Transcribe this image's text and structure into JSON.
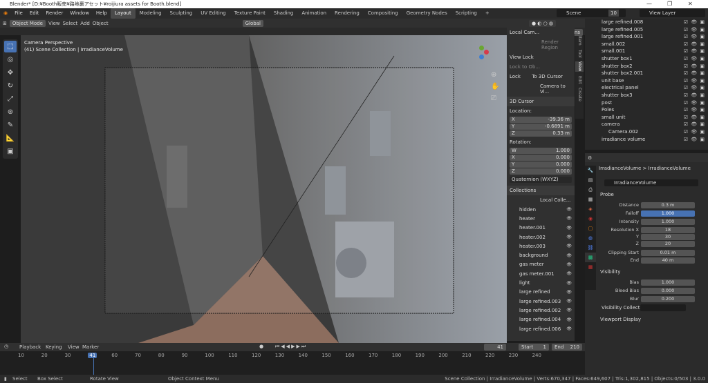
{
  "title": "Blender* [D:¥Booth販売¥路地裏アセット¥roijiura assets for Booth.blend]",
  "menu": [
    "File",
    "Edit",
    "Render",
    "Window",
    "Help"
  ],
  "workspaces": [
    "Layout",
    "Modeling",
    "Sculpting",
    "UV Editing",
    "Texture Paint",
    "Shading",
    "Animation",
    "Rendering",
    "Compositing",
    "Geometry Nodes",
    "Scripting"
  ],
  "scene_label": "Scene",
  "view_layer_label": "View Layer",
  "scene_num": "10",
  "viewport": {
    "mode": "Object Mode",
    "menus": [
      "View",
      "Select",
      "Add",
      "Object"
    ],
    "transform": "Global",
    "options": "Options",
    "camera_text": "Camera Perspective",
    "collection_text": "(41) Scene Collection | IrradianceVolume"
  },
  "npanel": {
    "tabs": [
      "Item",
      "Tool",
      "View",
      "Edit",
      "Create"
    ],
    "local_camera": "Local Cam...",
    "render_region": "Render Region",
    "view_lock": "View Lock",
    "lock_to_obj": "Lock to Ob...",
    "lock": "Lock",
    "to_3d_cursor": "To 3D Cursor",
    "camera_to_view": "Camera to Vi...",
    "cursor_title": "3D Cursor",
    "location": "Location:",
    "loc": [
      {
        "a": "X",
        "v": "-39.36 m"
      },
      {
        "a": "Y",
        "v": "-0.6891 m"
      },
      {
        "a": "Z",
        "v": "0.33 m"
      }
    ],
    "rotation": "Rotation:",
    "rot": [
      {
        "a": "W",
        "v": "1.000"
      },
      {
        "a": "X",
        "v": "0.000"
      },
      {
        "a": "Y",
        "v": "0.000"
      },
      {
        "a": "Z",
        "v": "0.000"
      }
    ],
    "rot_mode": "Quaternion (WXYZ)",
    "collections_title": "Collections",
    "local_collections": "Local Colle...",
    "collections": [
      "hidden",
      "heater",
      "heater.001",
      "heater.002",
      "heater.003",
      "background",
      "gas meter",
      "gas meter.001",
      "light",
      "large refined",
      "large refined.003",
      "large refined.002",
      "large refined.004",
      "large refined.006"
    ]
  },
  "outliner": [
    "large refined.008",
    "large refined.005",
    "large refined.001",
    "small.002",
    "small.001",
    "shutter box1",
    "shutter box2",
    "shutter box2.001",
    "unit base",
    "electrical panel",
    "shutter box3",
    "post",
    "Poles",
    "small unit",
    "camera",
    "Camera.002",
    "irradiance volume"
  ],
  "props": {
    "crumb1": "IrradianceVolume",
    "crumb2": "IrradianceVolume",
    "data_name": "IrradianceVolume",
    "probe": "Probe",
    "rows": [
      {
        "l": "Distance",
        "v": "0.3 m"
      },
      {
        "l": "Falloff",
        "v": "1.000"
      },
      {
        "l": "Intensity",
        "v": "1.000"
      },
      {
        "l": "Resolution X",
        "v": "18"
      },
      {
        "l": "Y",
        "v": "30"
      },
      {
        "l": "Z",
        "v": "20"
      },
      {
        "l": "Clipping Start",
        "v": "0.01 m"
      },
      {
        "l": "End",
        "v": "40 m"
      }
    ],
    "visibility": "Visibility",
    "vrows": [
      {
        "l": "Bias",
        "v": "1.000"
      },
      {
        "l": "Bleed Bias",
        "v": "0.000"
      },
      {
        "l": "Blur",
        "v": "0.200"
      }
    ],
    "vis_coll": "Visibility Collection",
    "viewport_display": "Viewport Display"
  },
  "timeline": {
    "menus": [
      "Playback",
      "Keying",
      "View",
      "Marker"
    ],
    "current": "41",
    "start_label": "Start",
    "start": "1",
    "end_label": "End",
    "end": "210",
    "ticks": [
      "10",
      "20",
      "30",
      "41",
      "60",
      "70",
      "80",
      "90",
      "100",
      "110",
      "120",
      "130",
      "140",
      "150",
      "160",
      "170",
      "180",
      "190",
      "200",
      "210",
      "220",
      "230",
      "240"
    ]
  },
  "status": {
    "select": "Select",
    "box_select": "Box Select",
    "rotate": "Rotate View",
    "context": "Object Context Menu",
    "info": "Scene Collection | IrradianceVolume | Verts:670,347 | Faces:649,607 | Tris:1,302,815 | Objects:0/503 | 3.0.0"
  }
}
